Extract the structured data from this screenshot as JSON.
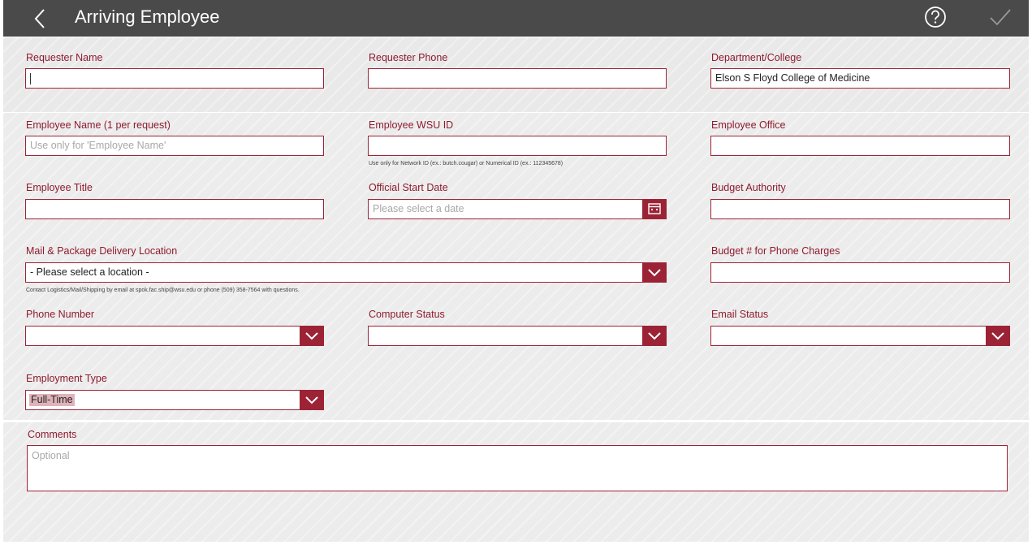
{
  "header": {
    "title": "Arriving Employee",
    "back_icon": "chevron-left-icon",
    "help_icon": "help-circle-icon",
    "submit_icon": "checkmark-icon"
  },
  "colors": {
    "header_bg": "#4a4a4a",
    "accent": "#9b2335",
    "label": "#8e1b2e"
  },
  "form": {
    "requester_name": {
      "label": "Requester Name",
      "value": ""
    },
    "requester_phone": {
      "label": "Requester Phone",
      "value": ""
    },
    "department": {
      "label": "Department/College",
      "value": "Elson S Floyd College of Medicine"
    },
    "employee_name": {
      "label": "Employee Name (1 per request)",
      "placeholder": "Use only for 'Employee Name'"
    },
    "employee_wsu_id": {
      "label": "Employee WSU ID",
      "value": "",
      "hint": "Use only for Network ID (ex.: butch.cougar) or Numerical ID (ex.: 112345678)"
    },
    "employee_office": {
      "label": "Employee Office",
      "value": ""
    },
    "employee_title": {
      "label": "Employee Title",
      "value": ""
    },
    "official_start_date": {
      "label": "Official Start Date",
      "placeholder": "Please select a date"
    },
    "budget_authority": {
      "label": "Budget Authority",
      "value": ""
    },
    "mail_location": {
      "label": "Mail & Package Delivery Location",
      "selected": "- Please select a location -",
      "hint": "Contact Logistics/Mail/Shipping by email at spok.fac.ship@wsu.edu or phone (509) 358-7564 with questions."
    },
    "budget_phone": {
      "label": "Budget # for Phone Charges",
      "value": ""
    },
    "phone_number": {
      "label": "Phone Number",
      "selected": ""
    },
    "computer_status": {
      "label": "Computer Status",
      "selected": ""
    },
    "email_status": {
      "label": "Email Status",
      "selected": ""
    },
    "employment_type": {
      "label": "Employment Type",
      "selected": "Full-Time"
    },
    "comments": {
      "label": "Comments",
      "placeholder": "Optional"
    }
  }
}
